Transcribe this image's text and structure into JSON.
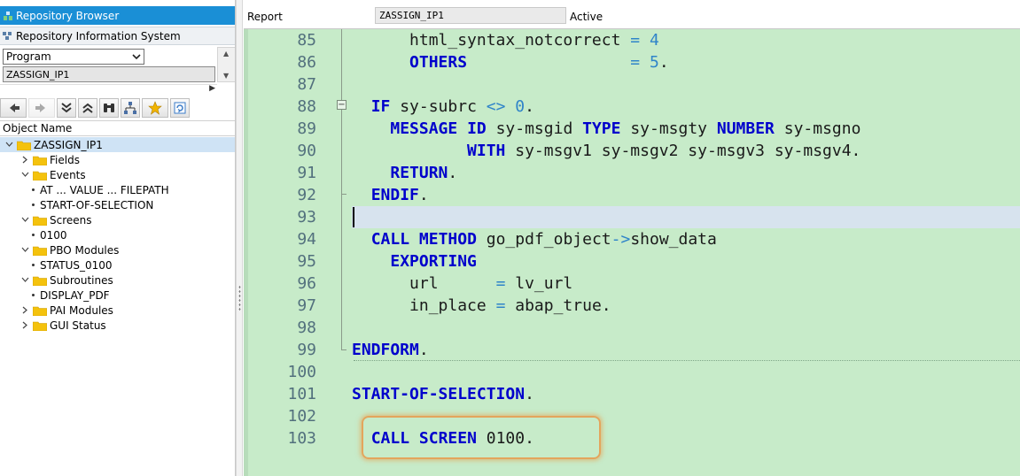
{
  "left_panel": {
    "repository_browser": "Repository Browser",
    "repository_info_system": "Repository Information System",
    "object_type": "Program",
    "object_name": "ZASSIGN_IP1",
    "column_header": "Object Name",
    "tree": [
      {
        "label": "ZASSIGN_IP1",
        "level": 0,
        "kind": "folder",
        "expanded": true,
        "selected": true
      },
      {
        "label": "Fields",
        "level": 1,
        "kind": "folder",
        "expanded": false
      },
      {
        "label": "Events",
        "level": 1,
        "kind": "folder",
        "expanded": true
      },
      {
        "label": "AT ... VALUE ... FILEPATH",
        "level": 2,
        "kind": "leaf"
      },
      {
        "label": "START-OF-SELECTION",
        "level": 2,
        "kind": "leaf"
      },
      {
        "label": "Screens",
        "level": 1,
        "kind": "folder",
        "expanded": true
      },
      {
        "label": "0100",
        "level": 2,
        "kind": "leaf"
      },
      {
        "label": "PBO Modules",
        "level": 1,
        "kind": "folder",
        "expanded": true
      },
      {
        "label": "STATUS_0100",
        "level": 2,
        "kind": "leaf"
      },
      {
        "label": "Subroutines",
        "level": 1,
        "kind": "folder",
        "expanded": true
      },
      {
        "label": "DISPLAY_PDF",
        "level": 2,
        "kind": "leaf"
      },
      {
        "label": "PAI Modules",
        "level": 1,
        "kind": "folder",
        "expanded": false
      },
      {
        "label": "GUI Status",
        "level": 1,
        "kind": "folder",
        "expanded": false
      }
    ]
  },
  "header": {
    "type_label": "Report",
    "program_name": "ZASSIGN_IP1",
    "status": "Active"
  },
  "editor": {
    "lines": [
      {
        "n": "85",
        "tokens": [
          [
            "t",
            "      html_syntax_notcorrect "
          ],
          [
            "o",
            "="
          ],
          [
            "t",
            " "
          ],
          [
            "n",
            "4"
          ]
        ]
      },
      {
        "n": "86",
        "tokens": [
          [
            "t",
            "      "
          ],
          [
            "k",
            "OTHERS"
          ],
          [
            "t",
            "                 "
          ],
          [
            "o",
            "="
          ],
          [
            "t",
            " "
          ],
          [
            "n",
            "5"
          ],
          [
            "t",
            "."
          ]
        ]
      },
      {
        "n": "87",
        "tokens": []
      },
      {
        "n": "88",
        "tokens": [
          [
            "t",
            "  "
          ],
          [
            "k",
            "IF"
          ],
          [
            "t",
            " sy-subrc "
          ],
          [
            "o",
            "<>"
          ],
          [
            "t",
            " "
          ],
          [
            "n",
            "0"
          ],
          [
            "t",
            "."
          ]
        ]
      },
      {
        "n": "89",
        "tokens": [
          [
            "t",
            "    "
          ],
          [
            "k",
            "MESSAGE"
          ],
          [
            "t",
            " "
          ],
          [
            "k",
            "ID"
          ],
          [
            "t",
            " sy-msgid "
          ],
          [
            "k",
            "TYPE"
          ],
          [
            "t",
            " sy-msgty "
          ],
          [
            "k",
            "NUMBER"
          ],
          [
            "t",
            " sy-msgno"
          ]
        ]
      },
      {
        "n": "90",
        "tokens": [
          [
            "t",
            "            "
          ],
          [
            "k",
            "WITH"
          ],
          [
            "t",
            " sy-msgv1 sy-msgv2 sy-msgv3 sy-msgv4."
          ]
        ]
      },
      {
        "n": "91",
        "tokens": [
          [
            "t",
            "    "
          ],
          [
            "k",
            "RETURN"
          ],
          [
            "t",
            "."
          ]
        ]
      },
      {
        "n": "92",
        "tokens": [
          [
            "t",
            "  "
          ],
          [
            "k",
            "ENDIF"
          ],
          [
            "t",
            "."
          ]
        ]
      },
      {
        "n": "93",
        "tokens": []
      },
      {
        "n": "94",
        "tokens": [
          [
            "t",
            "  "
          ],
          [
            "k",
            "CALL"
          ],
          [
            "t",
            " "
          ],
          [
            "k",
            "METHOD"
          ],
          [
            "t",
            " go_pdf_object"
          ],
          [
            "o",
            "->"
          ],
          [
            "t",
            "show_data"
          ]
        ]
      },
      {
        "n": "95",
        "tokens": [
          [
            "t",
            "    "
          ],
          [
            "k",
            "EXPORTING"
          ]
        ]
      },
      {
        "n": "96",
        "tokens": [
          [
            "t",
            "      url      "
          ],
          [
            "o",
            "="
          ],
          [
            "t",
            " lv_url"
          ]
        ]
      },
      {
        "n": "97",
        "tokens": [
          [
            "t",
            "      in_place "
          ],
          [
            "o",
            "="
          ],
          [
            "t",
            " abap_true."
          ]
        ]
      },
      {
        "n": "98",
        "tokens": []
      },
      {
        "n": "99",
        "tokens": [
          [
            "k",
            "ENDFORM"
          ],
          [
            "t",
            "."
          ]
        ]
      },
      {
        "n": "100",
        "tokens": []
      },
      {
        "n": "101",
        "tokens": [
          [
            "k",
            "START-OF-SELECTION"
          ],
          [
            "t",
            "."
          ]
        ]
      },
      {
        "n": "102",
        "tokens": []
      },
      {
        "n": "103",
        "tokens": [
          [
            "t",
            "  "
          ],
          [
            "k",
            "CALL"
          ],
          [
            "t",
            " "
          ],
          [
            "k",
            "SCREEN"
          ],
          [
            "t",
            " 0100."
          ]
        ]
      }
    ]
  },
  "colors": {
    "editor_bg": "#c7ebc9",
    "keyword": "#0000cc",
    "number": "#2f84c9",
    "header_blue": "#1a8fd6",
    "highlight": "#e3a55c"
  }
}
